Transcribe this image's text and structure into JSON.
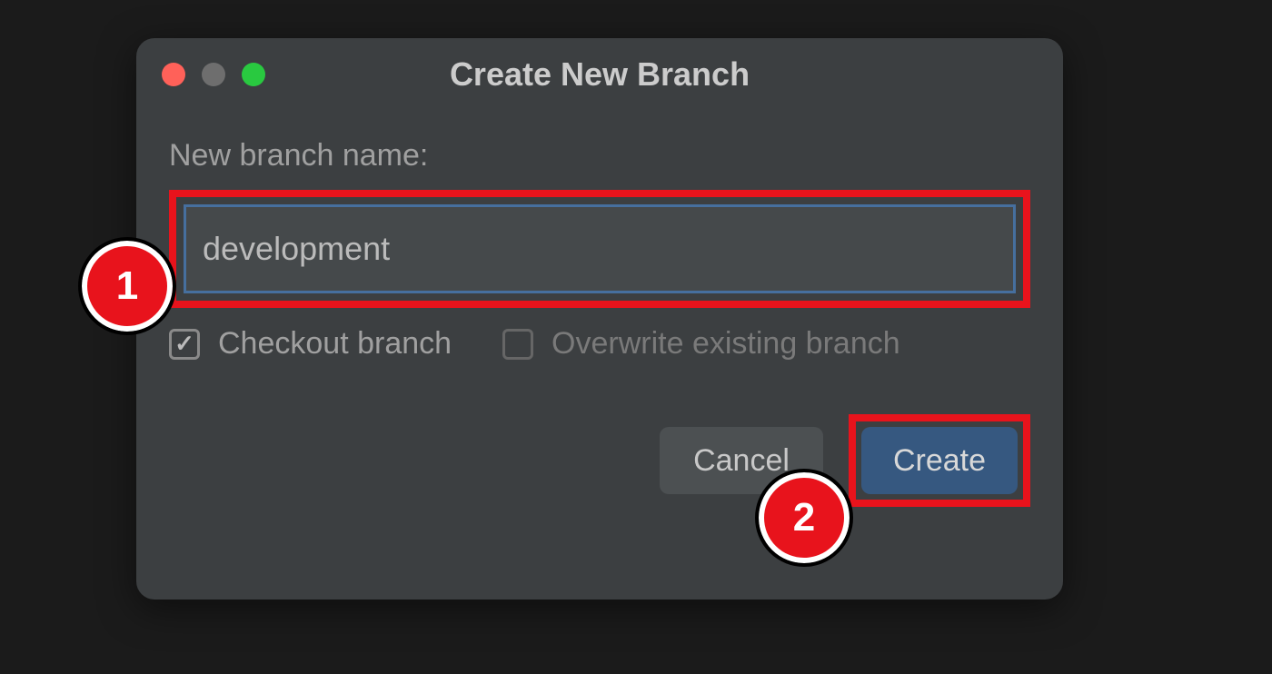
{
  "dialog": {
    "title": "Create New Branch",
    "field_label": "New branch name:",
    "branch_value": "development",
    "checkbox_checkout": {
      "label": "Checkout branch",
      "checked": true
    },
    "checkbox_overwrite": {
      "label": "Overwrite existing branch",
      "checked": false,
      "disabled": true
    },
    "buttons": {
      "cancel": "Cancel",
      "create": "Create"
    }
  },
  "annotations": {
    "step1": "1",
    "step2": "2"
  }
}
